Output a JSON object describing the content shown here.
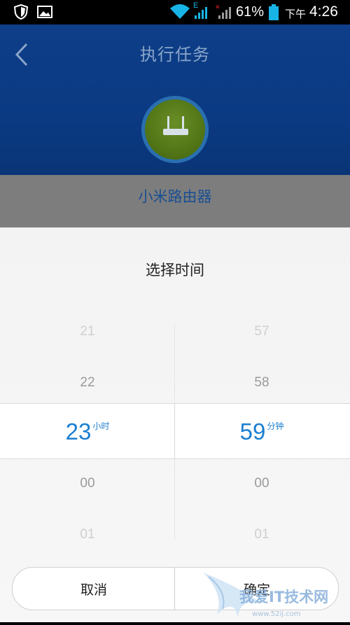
{
  "status_bar": {
    "network_type": "E",
    "battery_percent": "61%",
    "period": "下午",
    "time": "4:26"
  },
  "header": {
    "title": "执行任务",
    "device_name": "小米路由器"
  },
  "picker": {
    "title": "选择时间",
    "hours": {
      "items": [
        "21",
        "22",
        "23",
        "00",
        "01"
      ],
      "selected": "23",
      "unit": "小时"
    },
    "minutes": {
      "items": [
        "57",
        "58",
        "59",
        "00",
        "01"
      ],
      "selected": "59",
      "unit": "分钟"
    },
    "cancel_label": "取消",
    "confirm_label": "确定"
  },
  "watermark": {
    "text": "我爱IT技术网",
    "url": "www.52ij.com"
  },
  "colors": {
    "accent": "#1b7fd1",
    "header_bg": "#0e3e88",
    "device_green": "#5a7f1a"
  }
}
